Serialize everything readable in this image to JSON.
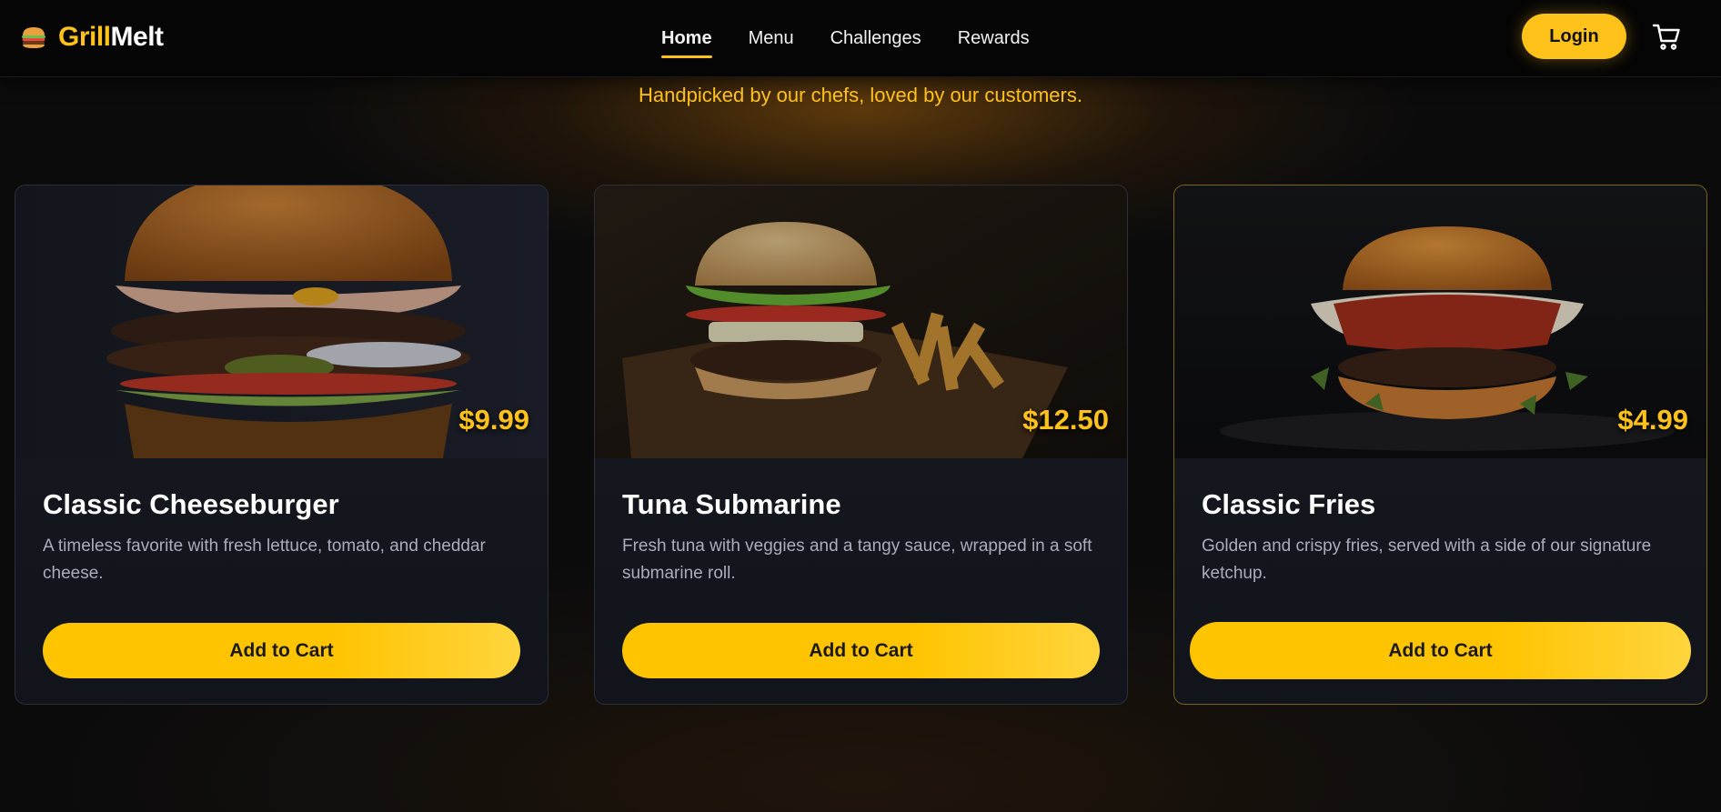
{
  "brand": {
    "part1": "Grill",
    "part2": "Melt",
    "logo_icon": "burger-icon"
  },
  "nav": {
    "items": [
      {
        "label": "Home",
        "active": true
      },
      {
        "label": "Menu",
        "active": false
      },
      {
        "label": "Challenges",
        "active": false
      },
      {
        "label": "Rewards",
        "active": false
      }
    ],
    "login_label": "Login",
    "cart_icon": "cart-icon"
  },
  "tagline": "Handpicked by our chefs, loved by our customers.",
  "colors": {
    "accent": "#ffc21a",
    "background": "#0b0b0c",
    "card": "#151920"
  },
  "products": [
    {
      "name": "Classic Cheeseburger",
      "price": "$9.99",
      "description": "A timeless favorite with fresh lettuce, tomato, and cheddar cheese.",
      "button": "Add to Cart"
    },
    {
      "name": "Tuna Submarine",
      "price": "$12.50",
      "description": "Fresh tuna with veggies and a tangy sauce, wrapped in a soft submarine roll.",
      "button": "Add to Cart"
    },
    {
      "name": "Classic Fries",
      "price": "$4.99",
      "description": "Golden and crispy fries, served with a side of our signature ketchup.",
      "button": "Add to Cart"
    }
  ]
}
